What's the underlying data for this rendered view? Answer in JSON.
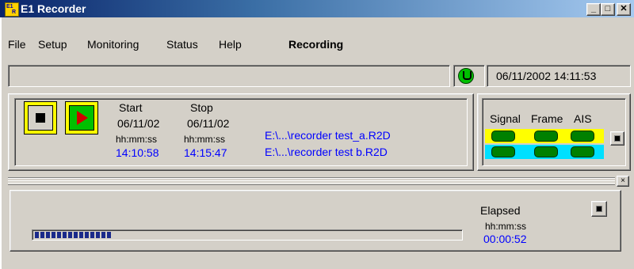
{
  "window": {
    "title": "E1 Recorder",
    "icon_text": {
      "top": "E1",
      "bottom": "R"
    },
    "buttons": {
      "minimize": "_",
      "maximize": "□",
      "close": "✕"
    }
  },
  "menu": {
    "items": [
      "File",
      "Setup",
      "Monitoring",
      "Status",
      "Help"
    ],
    "mode": "Recording"
  },
  "status": {
    "datetime": "06/11/2002 14:11:53",
    "icon": "green-connection-icon"
  },
  "recording": {
    "start_label": "Start",
    "stop_label": "Stop",
    "start_date": "06/11/02",
    "stop_date": "06/11/02",
    "time_format": "hh:mm:ss",
    "start_time": "14:10:58",
    "stop_time": "14:15:47",
    "files": [
      "E:\\...\\recorder test_a.R2D",
      "E:\\...\\recorder test  b.R2D"
    ]
  },
  "signal": {
    "headers": [
      "Signal",
      "Frame",
      "AIS"
    ],
    "row_colors": [
      "#ffff00",
      "#00e0ff"
    ],
    "led_color": "#008000"
  },
  "elapsed": {
    "label": "Elapsed",
    "format": "hh:mm:ss",
    "value": "00:00:52",
    "progress_fraction": 0.18
  },
  "panel_close": "×"
}
